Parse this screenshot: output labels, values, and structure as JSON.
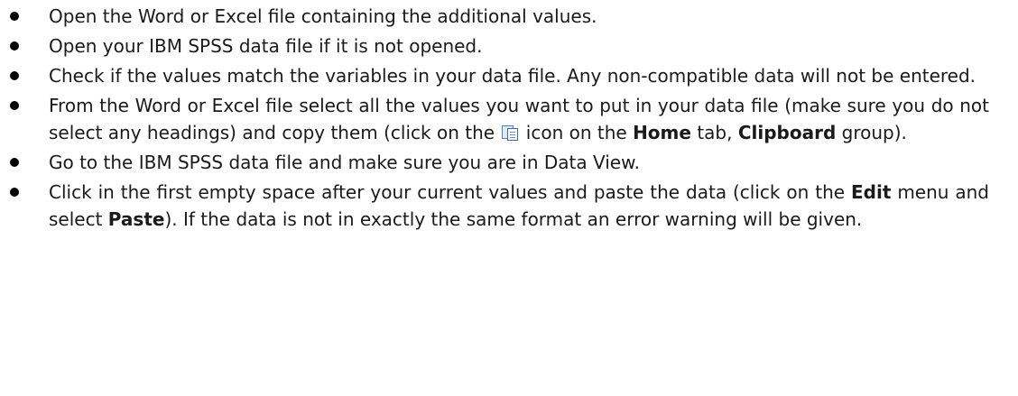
{
  "instructions": {
    "items": [
      {
        "text": "Open the Word or Excel file containing the additional values."
      },
      {
        "text": "Open your IBM SPSS data file if it is not opened."
      },
      {
        "text": "Check if the values match the variables in your data file. Any non-compatible data will not be entered."
      },
      {
        "t1": "From the Word or Excel file select all the values you want to put in your data file (make sure you do not select any headings) and copy them (click on the",
        "icon": "copy-icon",
        "t2": "icon on the",
        "b1": "Home",
        "t3": "tab,",
        "b2": "Clipboard",
        "t4": "group)."
      },
      {
        "text": "Go to the IBM SPSS data file and make sure you are in Data View."
      },
      {
        "t1": "Click in the first empty space after your current values and paste the data (click on the",
        "b1": "Edit",
        "t2": "menu and select",
        "b2": "Paste",
        "t3": "). If the data is not in exactly the same format an error warning will be given."
      }
    ]
  }
}
